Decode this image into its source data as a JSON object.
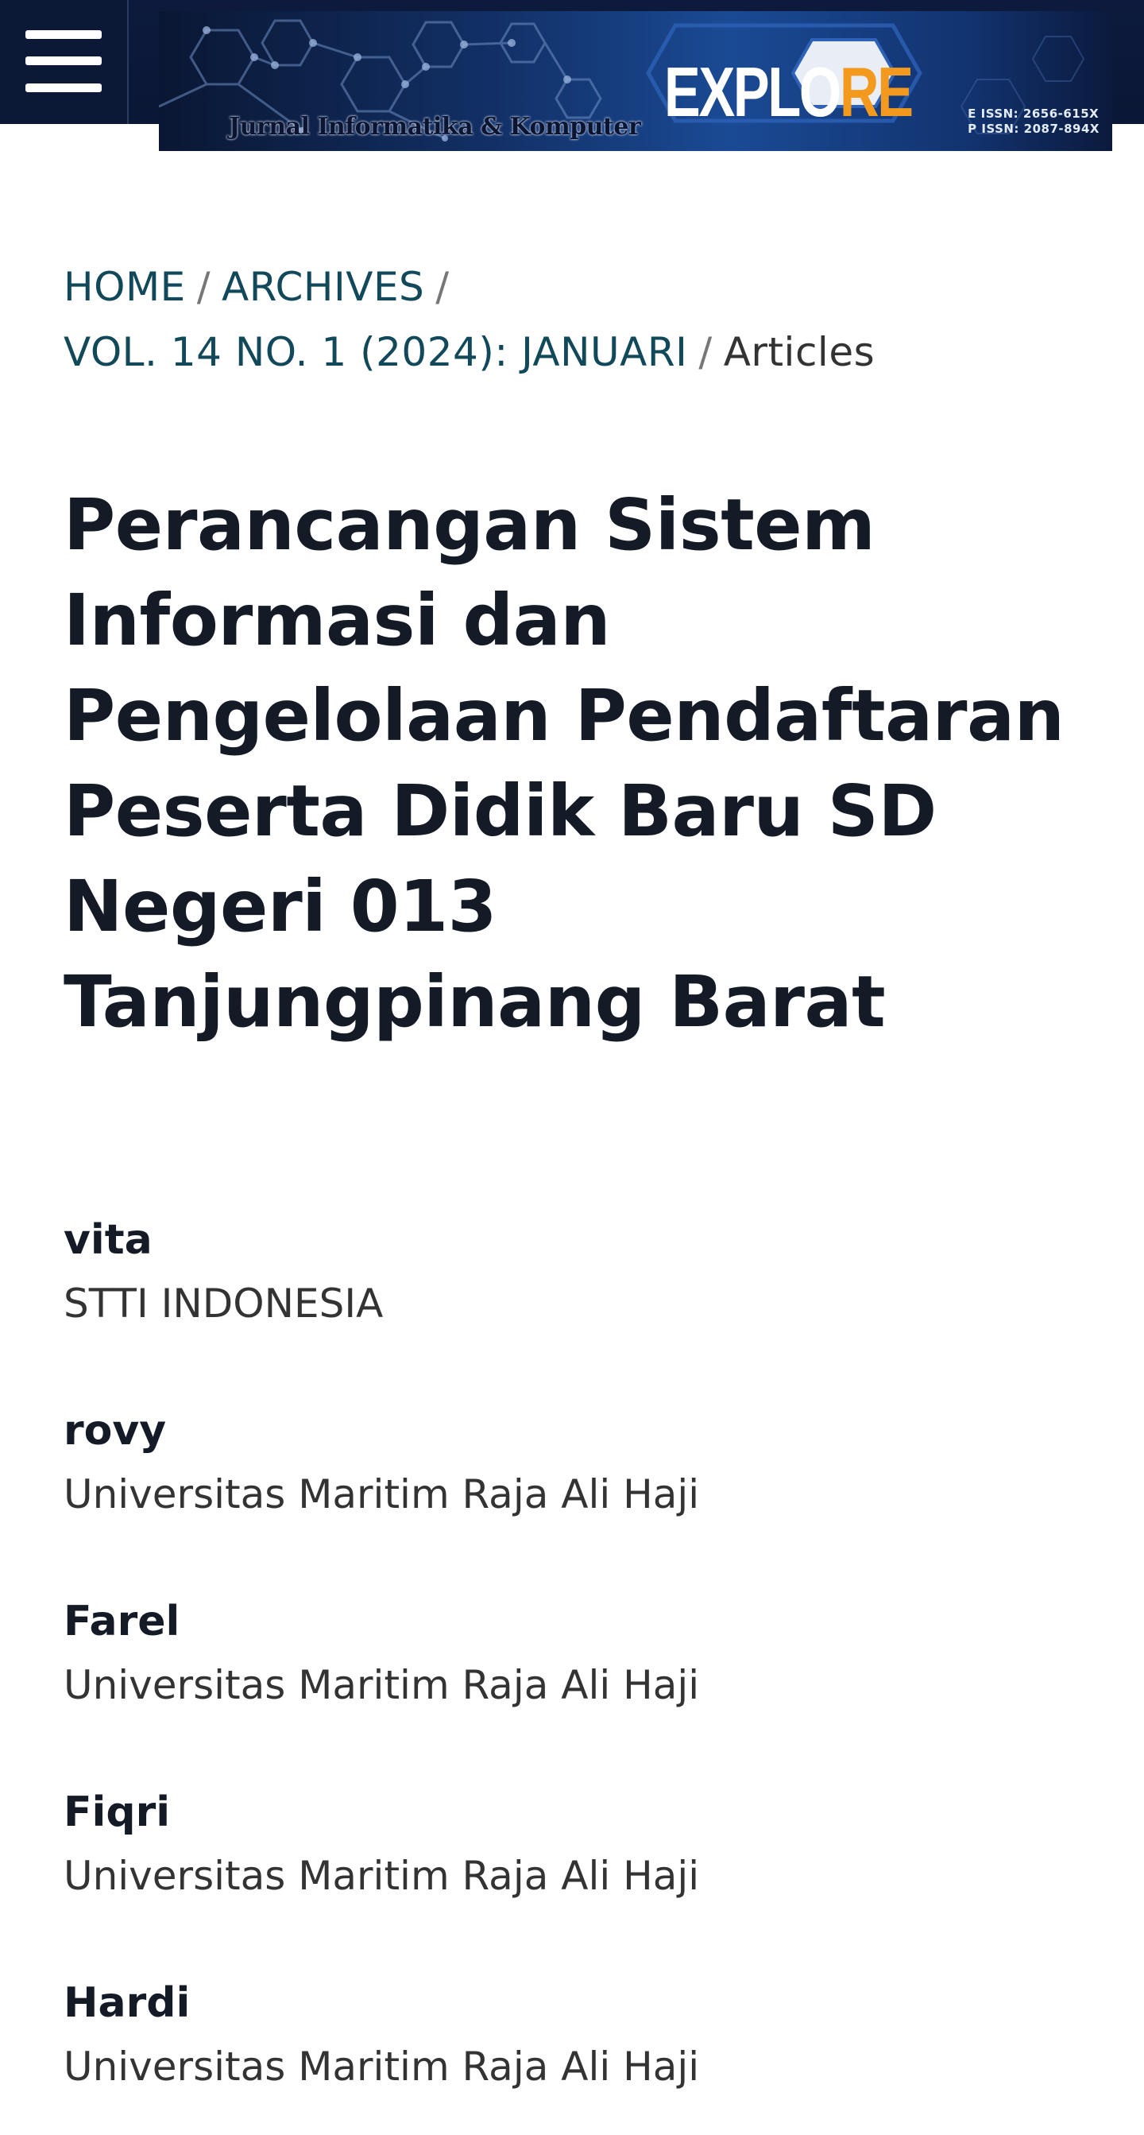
{
  "header": {
    "logo": {
      "part1": "EXPLO",
      "part2": "RE"
    },
    "tagline": "Jurnal Informatika & Komputer",
    "issn_electronic": "E ISSN: 2656-615X",
    "issn_print": "P ISSN: 2087-894X",
    "menu_icon": "hamburger-menu-icon"
  },
  "breadcrumb": {
    "home": "HOME",
    "archives": "ARCHIVES",
    "issue": "VOL. 14 NO. 1 (2024): JANUARI",
    "current": "Articles",
    "separator": "/"
  },
  "article": {
    "title": "Perancangan Sistem Informasi dan Pengelolaan Pendaftaran Peserta Didik Baru SD Negeri 013 Tanjungpinang Barat"
  },
  "authors": [
    {
      "name": "vita",
      "affiliation": "STTI INDONESIA"
    },
    {
      "name": "rovy",
      "affiliation": "Universitas Maritim Raja Ali Haji"
    },
    {
      "name": "Farel",
      "affiliation": "Universitas Maritim Raja Ali Haji"
    },
    {
      "name": "Fiqri",
      "affiliation": "Universitas Maritim Raja Ali Haji"
    },
    {
      "name": "Hardi",
      "affiliation": "Universitas Maritim Raja Ali Haji"
    }
  ],
  "colors": {
    "header_bg": "#0d1a3d",
    "link": "#11485a",
    "title": "#141b27",
    "logo_accent": "#f39a1e"
  }
}
